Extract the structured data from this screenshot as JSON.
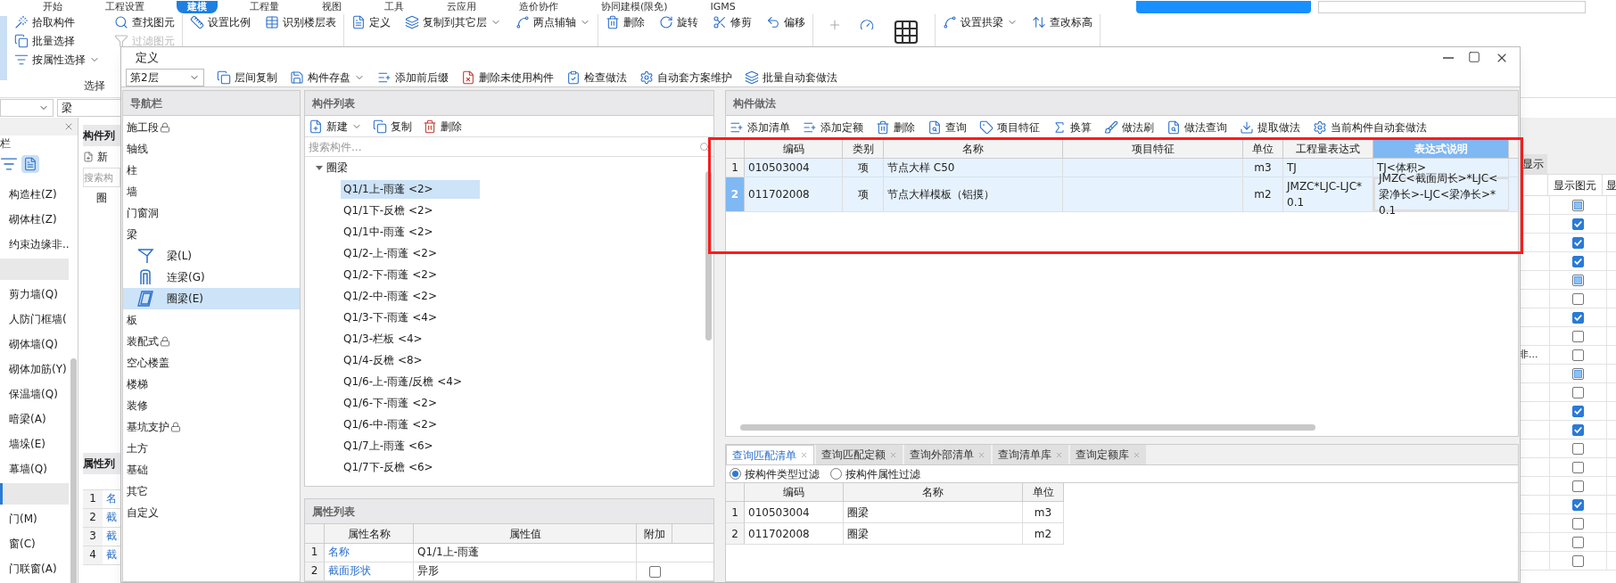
{
  "ribbon": {
    "tabs": [
      {
        "label": "开始",
        "selected": false
      },
      {
        "label": "工程设置",
        "selected": false
      },
      {
        "label": "建模",
        "selected": true
      },
      {
        "label": "工程量",
        "selected": false
      },
      {
        "label": "视图",
        "selected": false
      },
      {
        "label": "工具",
        "selected": false
      },
      {
        "label": "云应用",
        "selected": false
      },
      {
        "label": "造价协作",
        "selected": false
      },
      {
        "label": "协同建模(限免)",
        "selected": false
      },
      {
        "label": "IGMS",
        "selected": false
      }
    ],
    "groups": [
      {
        "caption": "选择",
        "columns": [
          [
            {
              "label": "拾取构件",
              "disabled": false,
              "dropdown": false
            },
            {
              "label": "批量选择",
              "disabled": false,
              "dropdown": false
            },
            {
              "label": "按属性选择",
              "disabled": false,
              "dropdown": true
            }
          ],
          [
            {
              "label": "查找图元",
              "disabled": false,
              "dropdown": false
            },
            {
              "label": "过滤图元",
              "disabled": true,
              "dropdown": false
            }
          ]
        ]
      },
      {
        "columns": [
          [
            {
              "label": "设置比例",
              "disabled": false,
              "dropdown": false
            }
          ],
          [
            {
              "label": "识别楼层表",
              "disabled": false,
              "dropdown": false
            }
          ]
        ]
      },
      {
        "columns": [
          [
            {
              "label": "定义",
              "disabled": false,
              "dropdown": false
            }
          ],
          [
            {
              "label": "复制到其它层",
              "disabled": false,
              "dropdown": true
            }
          ],
          [
            {
              "label": "两点辅轴",
              "disabled": false,
              "dropdown": true
            }
          ]
        ]
      },
      {
        "columns": [
          [
            {
              "label": "删除",
              "disabled": false,
              "dropdown": false
            }
          ],
          [
            {
              "label": "旋转",
              "disabled": false,
              "dropdown": false
            }
          ],
          [
            {
              "label": "修剪",
              "disabled": false,
              "dropdown": false
            }
          ],
          [
            {
              "label": "偏移",
              "disabled": false,
              "dropdown": false
            }
          ]
        ]
      },
      {
        "columns": [
          [
            {
              "label": "设置拱梁",
              "disabled": false,
              "dropdown": true
            }
          ],
          [
            {
              "label": "查改标高",
              "disabled": false,
              "dropdown": false
            }
          ]
        ]
      }
    ]
  },
  "left_panel": {
    "type_value": "梁",
    "title": "栏",
    "items": [
      {
        "kind": "item",
        "label": "构造柱(Z)",
        "selected": false
      },
      {
        "kind": "item",
        "label": "砌体柱(Z)",
        "selected": false
      },
      {
        "kind": "item",
        "label": "约束边缘非..",
        "selected": false
      },
      {
        "kind": "header",
        "selected": false
      },
      {
        "kind": "item",
        "label": "剪力墙(Q)",
        "selected": false
      },
      {
        "kind": "item",
        "label": "人防门框墙(",
        "selected": false
      },
      {
        "kind": "item",
        "label": "砌体墙(Q)",
        "selected": false
      },
      {
        "kind": "item",
        "label": "砌体加筋(Y)",
        "selected": false
      },
      {
        "kind": "item",
        "label": "保温墙(Q)",
        "selected": false
      },
      {
        "kind": "item",
        "label": "暗梁(A)",
        "selected": false
      },
      {
        "kind": "item",
        "label": "墙垛(E)",
        "selected": false
      },
      {
        "kind": "item",
        "label": "幕墙(Q)",
        "selected": false
      },
      {
        "kind": "header",
        "selected": true
      },
      {
        "kind": "item",
        "label": "门(M)",
        "selected": false
      },
      {
        "kind": "item",
        "label": "窗(C)",
        "selected": false
      },
      {
        "kind": "item",
        "label": "门联窗(A)",
        "selected": false
      }
    ]
  },
  "mid_strip": {
    "list_title": "构件列",
    "new": "新",
    "search": "搜索构",
    "tree_root": "圈",
    "props_title": "属性列",
    "rows": [
      {
        "num": "1",
        "name": "名"
      },
      {
        "num": "2",
        "name": "截"
      },
      {
        "num": "3",
        "name": "截"
      },
      {
        "num": "4",
        "name": "截"
      }
    ]
  },
  "display_panel": {
    "tab": "显示",
    "columns": [
      "显示图元",
      "显"
    ],
    "rows": [
      {
        "checked": false,
        "indeterminate": true
      },
      {
        "checked": true,
        "indeterminate": false
      },
      {
        "checked": true,
        "indeterminate": false
      },
      {
        "checked": true,
        "indeterminate": false
      },
      {
        "checked": false,
        "indeterminate": true
      },
      {
        "checked": false,
        "indeterminate": false
      },
      {
        "checked": true,
        "indeterminate": false
      },
      {
        "checked": false,
        "indeterminate": false
      },
      {
        "checked": false,
        "indeterminate": false,
        "label": "非..."
      },
      {
        "checked": false,
        "indeterminate": true
      },
      {
        "checked": false,
        "indeterminate": false
      },
      {
        "checked": true,
        "indeterminate": false
      },
      {
        "checked": true,
        "indeterminate": false
      },
      {
        "checked": false,
        "indeterminate": false
      },
      {
        "checked": false,
        "indeterminate": false
      },
      {
        "checked": false,
        "indeterminate": false
      },
      {
        "checked": true,
        "indeterminate": false
      },
      {
        "checked": false,
        "indeterminate": false
      },
      {
        "checked": false,
        "indeterminate": false
      },
      {
        "checked": false,
        "indeterminate": false
      }
    ]
  },
  "dialog": {
    "title": "定义",
    "floor": "第2层",
    "toolbar": [
      {
        "label": "层间复制",
        "dropdown": false
      },
      {
        "label": "构件存盘",
        "dropdown": true
      },
      {
        "label": "添加前后缀",
        "dropdown": false
      },
      {
        "label": "删除未使用构件",
        "dropdown": false
      },
      {
        "label": "检查做法",
        "dropdown": false
      },
      {
        "label": "自动套方案维护",
        "dropdown": false
      },
      {
        "label": "批量自动套做法",
        "dropdown": false
      }
    ],
    "nav": {
      "title": "导航栏",
      "items": [
        {
          "label": "施工段",
          "locked": true,
          "selected": false
        },
        {
          "label": "轴线",
          "locked": false,
          "selected": false
        },
        {
          "label": "柱",
          "locked": false,
          "selected": false
        },
        {
          "label": "墙",
          "locked": false,
          "selected": false
        },
        {
          "label": "门窗洞",
          "locked": false,
          "selected": false
        },
        {
          "label": "梁",
          "locked": false,
          "selected": false,
          "children": [
            {
              "label": "梁(L)",
              "selected": false
            },
            {
              "label": "连梁(G)",
              "selected": false
            },
            {
              "label": "圈梁(E)",
              "selected": true
            }
          ]
        },
        {
          "label": "板",
          "locked": false,
          "selected": false
        },
        {
          "label": "装配式",
          "locked": true,
          "selected": false
        },
        {
          "label": "空心楼盖",
          "locked": false,
          "selected": false
        },
        {
          "label": "楼梯",
          "locked": false,
          "selected": false
        },
        {
          "label": "装修",
          "locked": false,
          "selected": false
        },
        {
          "label": "基坑支护",
          "locked": true,
          "selected": false
        },
        {
          "label": "土方",
          "locked": false,
          "selected": false
        },
        {
          "label": "基础",
          "locked": false,
          "selected": false
        },
        {
          "label": "其它",
          "locked": false,
          "selected": false
        },
        {
          "label": "自定义",
          "locked": false,
          "selected": false
        }
      ]
    },
    "components": {
      "title": "构件列表",
      "toolbar": [
        {
          "label": "新建",
          "dropdown": true
        },
        {
          "label": "复制",
          "dropdown": false
        },
        {
          "label": "删除",
          "dropdown": false
        }
      ],
      "search": {
        "placeholder": "搜索构件..."
      },
      "tree": [
        {
          "label": "圈梁",
          "expanded": true,
          "children": [
            {
              "label": "Q1/1上-雨蓬 <2>",
              "selected": true
            },
            {
              "label": "Q1/1下-反檐 <2>",
              "selected": false
            },
            {
              "label": "Q1/1中-雨蓬 <2>",
              "selected": false
            },
            {
              "label": "Q1/2-上-雨蓬 <2>",
              "selected": false
            },
            {
              "label": "Q1/2-下-雨蓬 <2>",
              "selected": false
            },
            {
              "label": "Q1/2-中-雨蓬 <2>",
              "selected": false
            },
            {
              "label": "Q1/3-下-雨蓬 <4>",
              "selected": false
            },
            {
              "label": "Q1/3-栏板 <4>",
              "selected": false
            },
            {
              "label": "Q1/4-反檐 <8>",
              "selected": false
            },
            {
              "label": "Q1/6-上-雨蓬/反檐 <4>",
              "selected": false
            },
            {
              "label": "Q1/6-下-雨蓬 <2>",
              "selected": false
            },
            {
              "label": "Q1/6-中-雨蓬 <2>",
              "selected": false
            },
            {
              "label": "Q1/7上-雨蓬 <6>",
              "selected": false
            },
            {
              "label": "Q1/7下-反檐 <6>",
              "selected": false
            }
          ]
        }
      ]
    },
    "properties": {
      "title": "属性列表",
      "columns": [
        "属性名称",
        "属性值",
        "附加"
      ],
      "rows": [
        {
          "num": "1",
          "name": "名称",
          "value": "Q1/1上-雨蓬"
        },
        {
          "num": "2",
          "name": "截面形状",
          "value": "异形",
          "checked": false
        }
      ]
    },
    "methods": {
      "title": "构件做法",
      "toolbar": [
        "添加清单",
        "添加定额",
        "删除",
        "查询",
        "项目特征",
        "换算",
        "做法刷",
        "做法查询",
        "提取做法",
        "当前构件自动套做法"
      ],
      "columns": [
        {
          "label": "编码",
          "selected": false
        },
        {
          "label": "类别",
          "selected": false
        },
        {
          "label": "名称",
          "selected": false
        },
        {
          "label": "项目特征",
          "selected": false
        },
        {
          "label": "单位",
          "selected": false
        },
        {
          "label": "工程量表达式",
          "selected": false
        },
        {
          "label": "表达式说明",
          "selected": true
        }
      ],
      "rows": [
        {
          "num": "1",
          "selected": false,
          "cells": [
            "010503004",
            "项",
            "节点大样 C50",
            "",
            "m3",
            "TJ",
            "TJ<体积>"
          ]
        },
        {
          "num": "2",
          "selected": true,
          "cells": [
            "011702008",
            "项",
            "节点大样模板（铝摸）",
            "",
            "m2",
            "JMZC*LJC-LJC*0.1",
            "JMZC<截面周长>*LJC<梁净长>-LJC<梁净长>*0.1"
          ]
        }
      ]
    },
    "query": {
      "tabs": [
        {
          "label": "查询匹配清单",
          "selected": true
        },
        {
          "label": "查询匹配定额",
          "selected": false
        },
        {
          "label": "查询外部清单",
          "selected": false
        },
        {
          "label": "查询清单库",
          "selected": false
        },
        {
          "label": "查询定额库",
          "selected": false
        }
      ],
      "filters": [
        {
          "label": "按构件类型过滤",
          "selected": true
        },
        {
          "label": "按构件属性过滤",
          "selected": false
        }
      ],
      "columns": [
        "编码",
        "名称",
        "单位"
      ],
      "rows": [
        {
          "num": "1",
          "cells": [
            "010503004",
            "圈梁",
            "m3"
          ]
        },
        {
          "num": "2",
          "cells": [
            "011702008",
            "圈梁",
            "m2"
          ]
        }
      ]
    }
  }
}
